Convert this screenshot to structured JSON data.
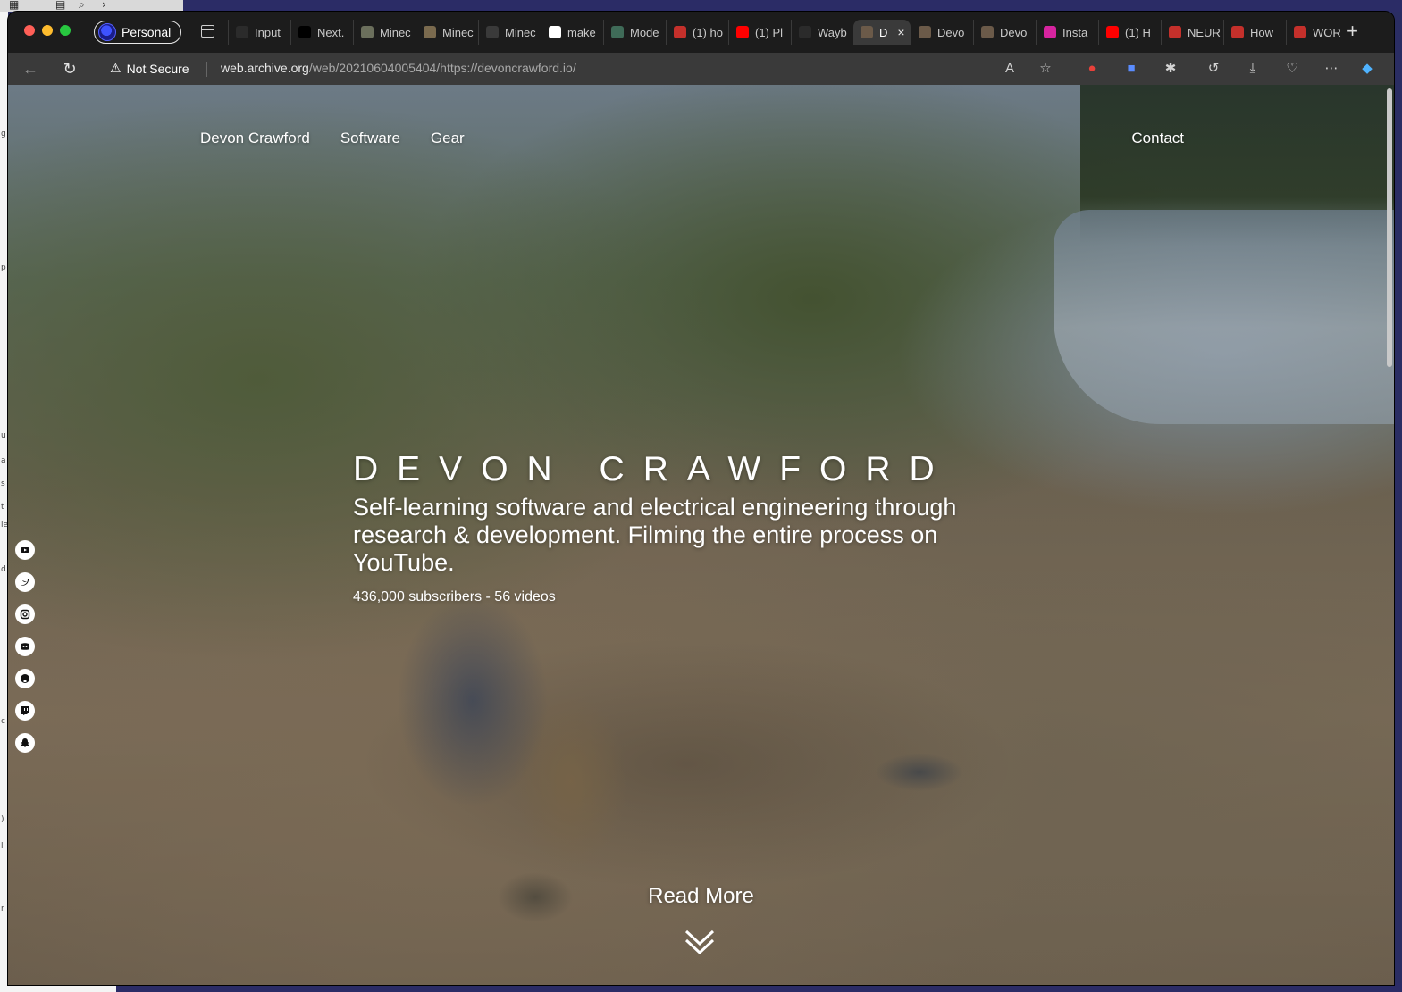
{
  "browser": {
    "profile_label": "Personal",
    "tabs": [
      {
        "label": "Input",
        "icon": "ui-icon",
        "color": "#2b2b2b"
      },
      {
        "label": "Next.",
        "icon": "nextjs-icon",
        "color": "#000000"
      },
      {
        "label": "Minec",
        "icon": "minecraft-icon",
        "color": "#6b6f5c"
      },
      {
        "label": "Minec",
        "icon": "minecraft-icon",
        "color": "#7a6a4e"
      },
      {
        "label": "Minec",
        "icon": "document-icon",
        "color": "#3a3a3a"
      },
      {
        "label": "make",
        "icon": "google-icon",
        "color": "#ffffff"
      },
      {
        "label": "Mode",
        "icon": "model-icon",
        "color": "#3f6b58"
      },
      {
        "label": "(1) ho",
        "icon": "youtube-icon",
        "color": "#c4302b"
      },
      {
        "label": "(1) Pl",
        "icon": "youtube-icon",
        "color": "#ff0000"
      },
      {
        "label": "Wayb",
        "icon": "wayback-icon",
        "color": "#2b2b2b"
      },
      {
        "label": "D",
        "icon": "devon-avatar-icon",
        "color": "#6b5a49",
        "active": true
      },
      {
        "label": "Devo",
        "icon": "devon-avatar-icon",
        "color": "#6b5a49"
      },
      {
        "label": "Devo",
        "icon": "devon-avatar-icon",
        "color": "#6b5a49"
      },
      {
        "label": "Insta",
        "icon": "instagram-icon",
        "color": "#d6249f"
      },
      {
        "label": "(1) H",
        "icon": "youtube-icon",
        "color": "#ff0000"
      },
      {
        "label": "NEUR",
        "icon": "youtube-icon",
        "color": "#c4302b"
      },
      {
        "label": "How",
        "icon": "youtube-icon",
        "color": "#c4302b"
      },
      {
        "label": "WOR",
        "icon": "youtube-icon",
        "color": "#c4302b"
      }
    ],
    "security_label": "Not Secure",
    "url_domain": "web.archive.org",
    "url_path": "/web/20210604005404/https://devoncrawford.io/"
  },
  "site": {
    "nav": [
      "Devon Crawford",
      "Software",
      "Gear"
    ],
    "contact": "Contact",
    "hero_title": "DEVON CRAWFORD",
    "hero_tagline": "Self-learning software and electrical engineering through research & development. Filming the entire process on YouTube.",
    "hero_stats": "436,000 subscribers - 56 videos",
    "read_more": "Read More",
    "social_icons": [
      "youtube-icon",
      "twitter-icon",
      "instagram-icon",
      "discord-icon",
      "github-icon",
      "twitch-icon",
      "snapchat-icon"
    ]
  },
  "colors": {
    "accent": "#ffffff",
    "tabbar": "#1c1c1c",
    "toolbar": "#3a3a3a"
  }
}
